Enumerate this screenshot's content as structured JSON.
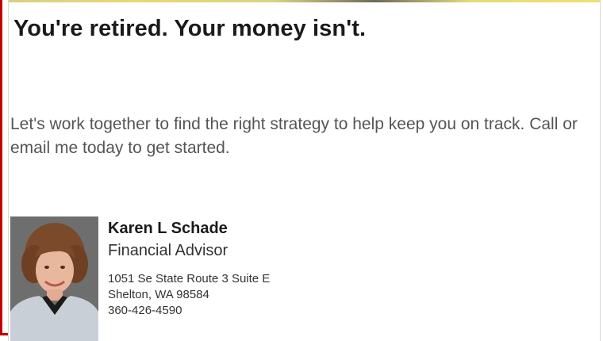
{
  "headline": "You're retired. Your money isn't.",
  "body_text": "Let's work together to find the right strategy to help keep you on track. Call or email me today to get started.",
  "advisor": {
    "name": "Karen L Schade",
    "title": "Financial Advisor",
    "address_line1": "1051 Se State Route 3 Suite E",
    "address_line2": "Shelton, WA 98584",
    "phone": "360-426-4590"
  },
  "colors": {
    "accent_bar": "#c00000",
    "headline": "#1a1a1a",
    "body_text": "#555555"
  }
}
